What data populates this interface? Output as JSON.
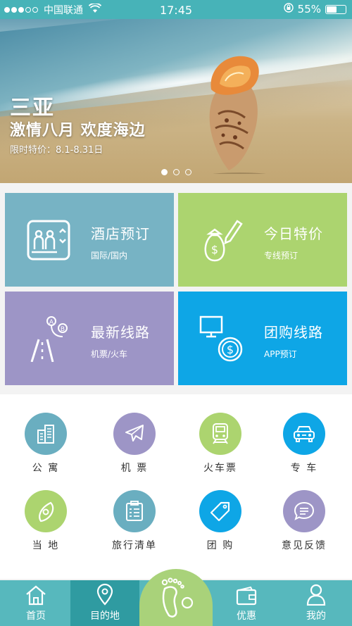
{
  "status": {
    "carrier": "中国联通",
    "time": "17:45",
    "battery": "55%",
    "battery_level": 0.55,
    "signal_bars": 3
  },
  "banner": {
    "title": "三亚",
    "subtitle": "激情八月 欢度海边",
    "promo": "限时特价：8.1-8.31日",
    "pages": 3,
    "active_page": 1
  },
  "tiles": [
    {
      "title": "酒店预订",
      "subtitle": "国际/国内",
      "icon": "hotel-icon",
      "color": "#77b3c4"
    },
    {
      "title": "今日特价",
      "subtitle": "专线预订",
      "icon": "money-bag-icon",
      "color": "#acd46f"
    },
    {
      "title": "最新线路",
      "subtitle": "机票/火车",
      "icon": "route-icon",
      "color": "#9d95c6"
    },
    {
      "title": "团购线路",
      "subtitle": "APP预订",
      "icon": "group-buy-icon",
      "color": "#0ea6e6"
    }
  ],
  "grid": [
    {
      "label": "公 寓",
      "icon": "building-icon",
      "color": "#6aaec0"
    },
    {
      "label": "机 票",
      "icon": "airplane-icon",
      "color": "#9d95c6"
    },
    {
      "label": "火车票",
      "icon": "train-icon",
      "color": "#acd46f"
    },
    {
      "label": "专 车",
      "icon": "car-icon",
      "color": "#0ea6e6"
    },
    {
      "label": "当 地",
      "icon": "location-icon",
      "color": "#acd46f"
    },
    {
      "label": "旅行清单",
      "icon": "checklist-icon",
      "color": "#6aaec0"
    },
    {
      "label": "团 购",
      "icon": "tag-icon",
      "color": "#0ea6e6"
    },
    {
      "label": "意见反馈",
      "icon": "feedback-icon",
      "color": "#9d95c6"
    }
  ],
  "tabbar": {
    "items": [
      {
        "label": "首页",
        "icon": "home-icon"
      },
      {
        "label": "目的地",
        "icon": "map-pin-icon"
      },
      {
        "label": "优惠",
        "icon": "wallet-icon"
      },
      {
        "label": "我的",
        "icon": "user-icon"
      }
    ],
    "selected": "目的地",
    "center_icon": "footprint-icon"
  },
  "colors": {
    "status_bar": "#47b3b8",
    "tabbar": "#57b8bd",
    "tabbar_selected": "#2f9ba1",
    "center_button": "#a9d27a"
  }
}
